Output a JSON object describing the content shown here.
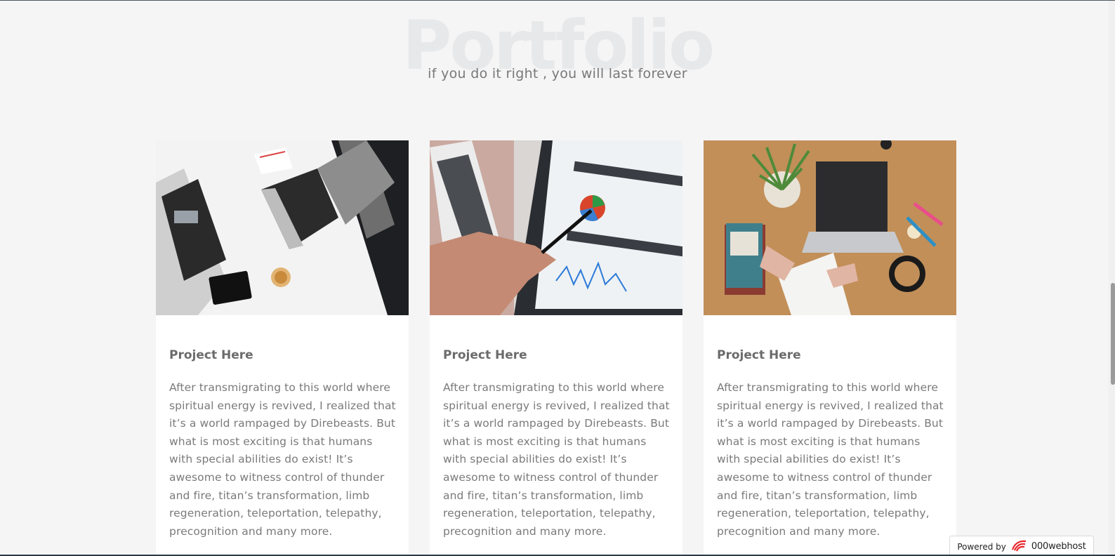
{
  "section": {
    "background_title": "Portfolio",
    "subtitle": "if you do it right , you will last forever"
  },
  "projects": [
    {
      "image": "office-desk-laptop-photo",
      "title": "Project Here",
      "description": "After transmigrating to this world where spiritual energy is revived, I realized that it’s a world rampaged by Direbeasts. But what is most exciting is that humans with special abilities do exist! It’s awesome to witness control of thunder and fire, titan’s transformation, limb regeneration, teleportation, telepathy, precognition and many more."
    },
    {
      "image": "analytics-tablet-chart-photo",
      "title": "Project Here",
      "description": "After transmigrating to this world where spiritual energy is revived, I realized that it’s a world rampaged by Direbeasts. But what is most exciting is that humans with special abilities do exist! It’s awesome to witness control of thunder and fire, titan’s transformation, limb regeneration, teleportation, telepathy, precognition and many more."
    },
    {
      "image": "wooden-desk-laptop-book-photo",
      "title": "Project Here",
      "description": "After transmigrating to this world where spiritual energy is revived, I realized that it’s a world rampaged by Direbeasts. But what is most exciting is that humans with special abilities do exist! It’s awesome to witness control of thunder and fire, titan’s transformation, limb regeneration, teleportation, telepathy, precognition and many more."
    }
  ],
  "badge": {
    "label": "Powered by",
    "brand": "000webhost",
    "icon": "000webhost-logo-icon"
  },
  "colors": {
    "background": "#f5f5f5",
    "card": "#ffffff",
    "title_text": "#6b6b6b",
    "body_text": "#7a7a7a",
    "brand_red": "#e8262b"
  }
}
